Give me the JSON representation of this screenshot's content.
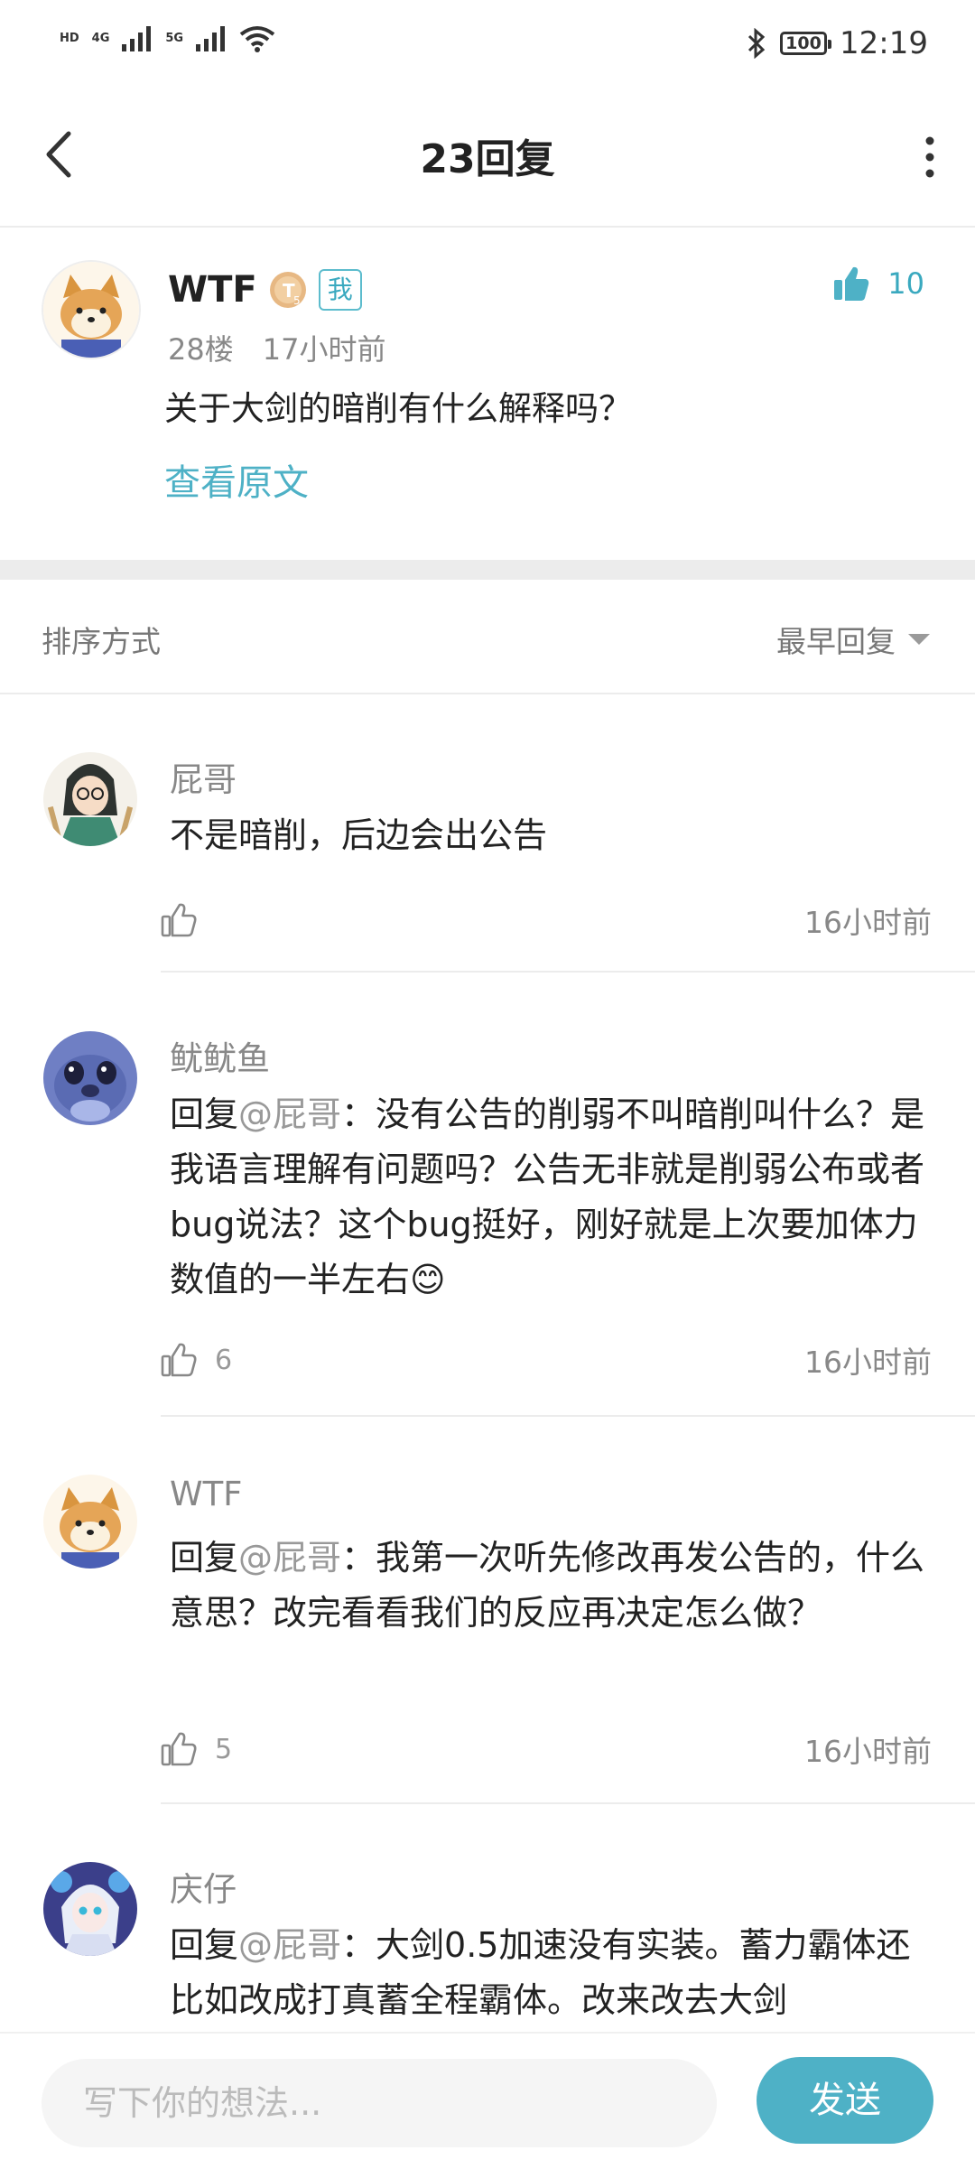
{
  "status_bar": {
    "left": [
      "HD",
      "4G",
      "5G"
    ],
    "battery": "100",
    "time": "12:19"
  },
  "header": {
    "title": "23回复"
  },
  "original_post": {
    "author": "WTF",
    "level": "T5",
    "me_badge": "我",
    "floor": "28楼",
    "time": "17小时前",
    "content": "关于大剑的暗削有什么解释吗？",
    "view_original": "查看原文",
    "like_count": "10"
  },
  "sort": {
    "label": "排序方式",
    "selected": "最早回复"
  },
  "replies": [
    {
      "name": "屁哥",
      "mention": "",
      "prefix": "",
      "text": "不是暗削，后边会出公告",
      "likes": "",
      "time": "16小时前"
    },
    {
      "name": "鱿鱿鱼",
      "prefix": "回复",
      "mention": "@屁哥",
      "text": "：没有公告的削弱不叫暗削叫什么？是我语言理解有问题吗？公告无非就是削弱公布或者bug说法？这个bug挺好，刚好就是上次要加体力数值的一半左右😊",
      "likes": "6",
      "time": "16小时前"
    },
    {
      "name": "WTF",
      "prefix": "回复",
      "mention": "@屁哥",
      "text": "：我第一次听先修改再发公告的，什么意思？改完看看我们的反应再决定怎么做？",
      "likes": "5",
      "time": "16小时前"
    },
    {
      "name": "庆仔",
      "prefix": "回复",
      "mention": "@屁哥",
      "text": "：大剑0.5加速没有实装。蓄力霸体还比如改成打真蓄全程霸体。改来改去大剑",
      "likes": "",
      "time": ""
    }
  ],
  "input_bar": {
    "placeholder": "写下你的想法...",
    "send_label": "发送"
  },
  "colors": {
    "accent": "#4eb1c6",
    "text": "#222222",
    "muted": "#888888",
    "divider": "#ececec"
  }
}
